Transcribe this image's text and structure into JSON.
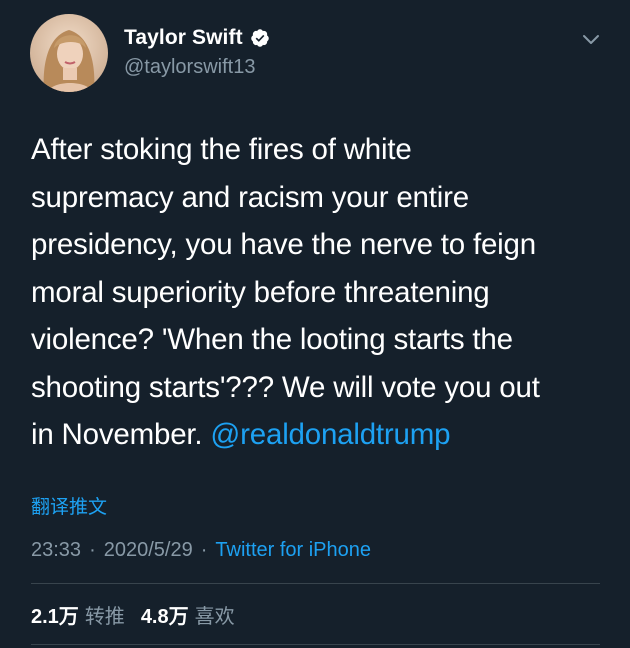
{
  "user": {
    "display_name": "Taylor Swift",
    "handle": "@taylorswift13",
    "verified": true
  },
  "tweet": {
    "lines": [
      "After stoking the fires of white",
      "supremacy and racism your entire",
      "presidency, you have the nerve to feign",
      "moral superiority before threatening",
      "violence? 'When the looting starts the",
      "shooting starts'??? We will vote you out"
    ],
    "last_line_text": "in November. ",
    "mention": "@realdonaldtrump"
  },
  "translate_label": "翻译推文",
  "meta": {
    "time": "23:33",
    "separator": "·",
    "date": "2020/5/29",
    "source": "Twitter for iPhone"
  },
  "stats": {
    "retweets_count": "2.1万",
    "retweets_label": "转推",
    "likes_count": "4.8万",
    "likes_label": "喜欢"
  },
  "colors": {
    "background": "#15202b",
    "text": "#ffffff",
    "secondary": "#8899a6",
    "accent": "#1da1f2",
    "divider": "#38444d"
  },
  "icons": {
    "verified": "verified-badge-icon",
    "menu": "chevron-down-icon"
  }
}
